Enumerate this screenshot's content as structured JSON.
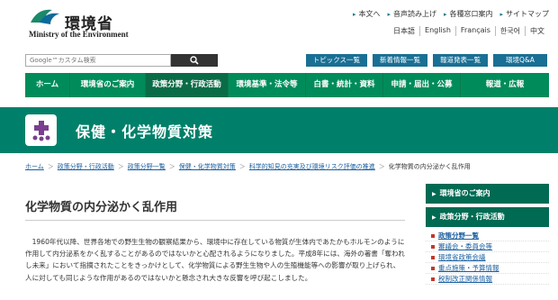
{
  "header": {
    "logo_ja": "環境省",
    "logo_en": "Ministry of the Environment",
    "util_links": [
      "本文へ",
      "音声読み上げ",
      "各種窓口案内",
      "サイトマップ"
    ],
    "lang_links": [
      "日本語",
      "English",
      "Français",
      "한국어",
      "中文"
    ]
  },
  "search": {
    "placeholder": "Google™カスタム検索"
  },
  "quick_buttons": [
    "トピックス一覧",
    "新着情報一覧",
    "報道発表一覧",
    "環境Q&A"
  ],
  "nav": {
    "items": [
      "ホーム",
      "環境省のご案内",
      "政策分野・行政活動",
      "環境基準・法令等",
      "白書・統計・資料",
      "申請・届出・公募",
      "報道・広報"
    ],
    "active_index": 2
  },
  "banner": {
    "title": "保健・化学物質対策"
  },
  "breadcrumb": [
    "ホーム",
    "政策分野・行政活動",
    "政策分野一覧",
    "保健・化学物質対策",
    "科学的知見の充実及び環境リスク評価の推進",
    "化学物質の内分泌かく乱作用"
  ],
  "main": {
    "title": "化学物質の内分泌かく乱作用",
    "paragraph": "1960年代以降、世界各地での野生生物の観察結果から、環境中に存在している物質が生体内であたかもホルモンのように作用して内分泌系をかく乱することがあるのではないかと心配されるようになりました。平成8年には、海外の著書「奪われし未来」において指摘されたことをきっかけとして、化学物質による野生生物や人の生殖機能等への影響が取り上げられ、人に対しても同じような作用があるのではないかと懸念され大きな反響を呼び起こしました。"
  },
  "sidebar": {
    "section1": "環境省のご案内",
    "section2": "政策分野・行政活動",
    "items": [
      "政策分野一覧",
      "審議会・委員会等",
      "環境省政策会議",
      "重点施策・予算情報",
      "税制改正関係情報"
    ]
  },
  "colors": {
    "nav_green": "#008c5a",
    "banner_green": "#00806a",
    "quick_blue": "#1a6f94",
    "link_blue": "#1a5fa0"
  }
}
